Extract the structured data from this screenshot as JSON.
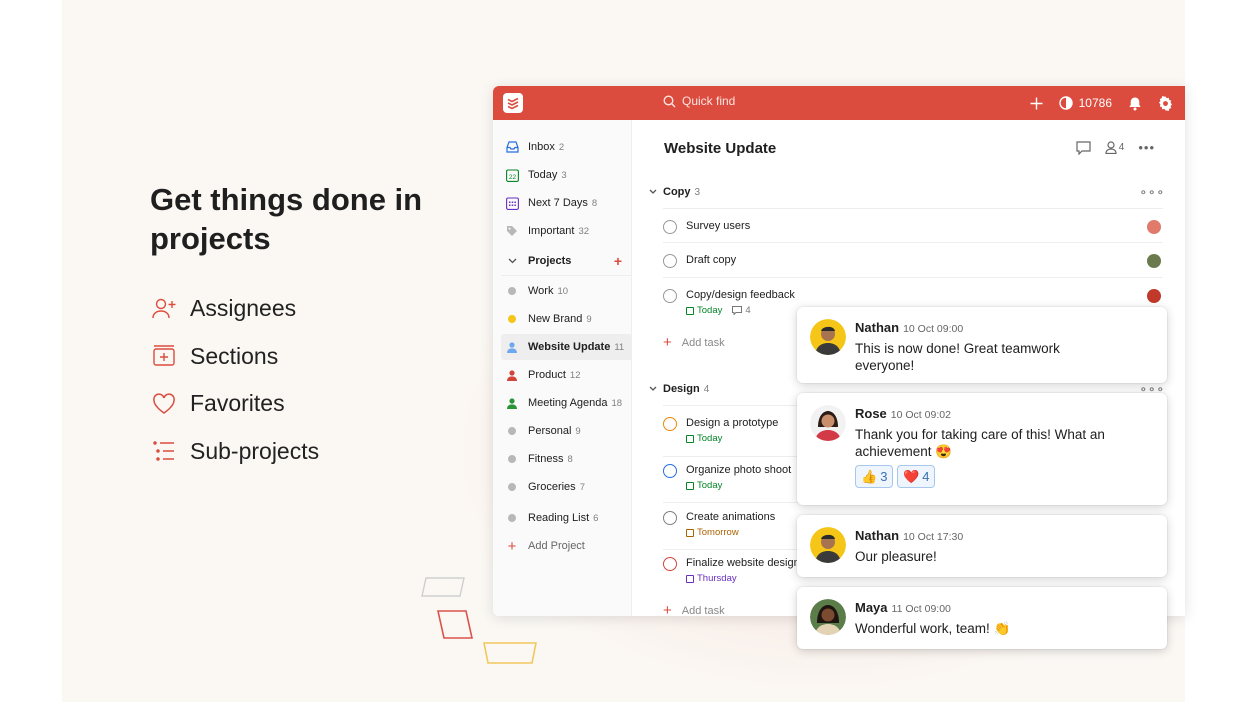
{
  "hero": {
    "headline": "Get things done in projects",
    "features": [
      {
        "icon": "user-plus-icon",
        "label": "Assignees"
      },
      {
        "icon": "section-icon",
        "label": "Sections"
      },
      {
        "icon": "heart-icon",
        "label": "Favorites"
      },
      {
        "icon": "sub-projects-icon",
        "label": "Sub-projects"
      }
    ]
  },
  "topbar": {
    "search_placeholder": "Quick find",
    "karma": "10786"
  },
  "sidebar": {
    "nav": [
      {
        "label": "Inbox",
        "count": "2",
        "icon": "inbox-icon"
      },
      {
        "label": "Today",
        "count": "3",
        "icon": "calendar-today-icon",
        "day": "22"
      },
      {
        "label": "Next 7 Days",
        "count": "8",
        "icon": "calendar-week-icon"
      },
      {
        "label": "Important",
        "count": "32",
        "icon": "tag-icon"
      }
    ],
    "projects_label": "Projects",
    "projects": [
      {
        "label": "Work",
        "count": "10",
        "color": "#b8b8b8",
        "shape": "dot"
      },
      {
        "label": "New Brand",
        "count": "9",
        "color": "#f5c518",
        "shape": "dot"
      },
      {
        "label": "Website Update",
        "count": "11",
        "color": "#6ea8f0",
        "shape": "person",
        "active": true
      },
      {
        "label": "Product",
        "count": "12",
        "color": "#d1453b",
        "shape": "person"
      },
      {
        "label": "Meeting Agenda",
        "count": "18",
        "color": "#299438",
        "shape": "person"
      },
      {
        "label": "Personal",
        "count": "9",
        "color": "#b8b8b8",
        "shape": "dot"
      },
      {
        "label": "Fitness",
        "count": "8",
        "color": "#b8b8b8",
        "shape": "dot"
      },
      {
        "label": "Groceries",
        "count": "7",
        "color": "#b8b8b8",
        "shape": "dot"
      },
      {
        "label": "Reading List",
        "count": "6",
        "color": "#b8b8b8",
        "shape": "dot"
      }
    ],
    "add_project": "Add Project"
  },
  "main": {
    "title": "Website Update",
    "collaborators": "4",
    "sections": [
      {
        "name": "Copy",
        "count": "3",
        "tasks": [
          {
            "name": "Survey users",
            "avatar_color": "#e07a6a"
          },
          {
            "name": "Draft copy",
            "avatar_color": "#6b7a4c"
          },
          {
            "name": "Copy/design feedback",
            "due": "Today",
            "due_color": "#058527",
            "comments": "4",
            "avatar_color": "#c0392b"
          }
        ],
        "add_task": "Add task"
      },
      {
        "name": "Design",
        "count": "4",
        "tasks": [
          {
            "name": "Design a prototype",
            "due": "Today",
            "due_color": "#058527",
            "priority_color": "#eb8909"
          },
          {
            "name": "Organize photo shoot",
            "due": "Today",
            "due_color": "#058527",
            "priority_color": "#246fe0"
          },
          {
            "name": "Create animations",
            "due": "Tomorrow",
            "due_color": "#ad6200",
            "priority_color": "#808080"
          },
          {
            "name": "Finalize website design",
            "due": "Thursday",
            "due_color": "#692fc2",
            "priority_color": "#d1453b"
          }
        ],
        "add_task": "Add task"
      }
    ]
  },
  "comments": [
    {
      "name": "Nathan",
      "time": "10 Oct 09:00",
      "text": "This is now done! Great teamwork everyone!"
    },
    {
      "name": "Rose",
      "time": "10 Oct 09:02",
      "text": "Thank you for taking care of this! What an achievement 😍",
      "reactions": [
        {
          "emoji": "👍",
          "count": "3"
        },
        {
          "emoji": "❤️",
          "count": "4"
        }
      ]
    },
    {
      "name": "Nathan",
      "time": "10 Oct 17:30",
      "text": "Our pleasure!"
    },
    {
      "name": "Maya",
      "time": "11 Oct 09:00",
      "text": "Wonderful work, team! 👏"
    }
  ],
  "colors": {
    "brand": "#db4c3f",
    "reaction_border": "#a7c7ed"
  }
}
